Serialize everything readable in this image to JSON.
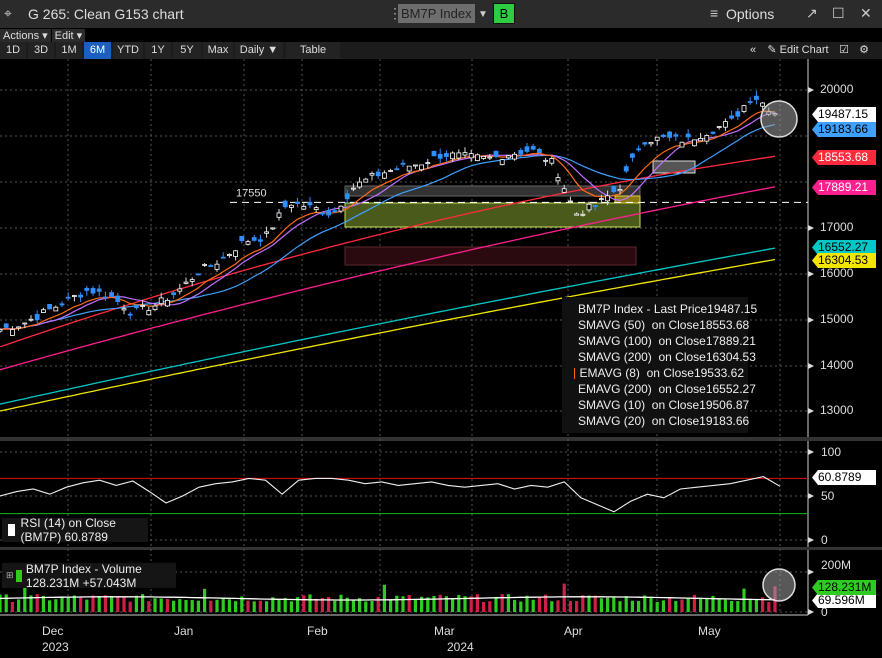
{
  "window": {
    "title": "G 265: Clean G153 chart",
    "ticker": "BM7P Index",
    "b_button": "B",
    "options": "Options",
    "move_icon": "crosshair-move-icon"
  },
  "menus": {
    "actions": "Actions ▾",
    "edit": "Edit ▾"
  },
  "ranges": [
    "1D",
    "3D",
    "1M",
    "6M",
    "YTD",
    "1Y",
    "5Y",
    "Max"
  ],
  "active_range": "6M",
  "frequency": "Daily ▼",
  "table": "Table",
  "edit_chart": "Edit Chart",
  "colors": {
    "up": "#ffffff",
    "down": "#2f8fff",
    "sma50": "#ff2a3c",
    "sma100": "#ff1f8f",
    "sma200": "#f2e600",
    "ema8": "#ff6a13",
    "ema200": "#00c8c8",
    "sma10": "#c070ff",
    "sma20": "#3fa0ff",
    "vol_up": "#2ecc20",
    "vol_down": "#d0204a"
  },
  "chart_data": {
    "type": "candlestick",
    "period": "Dec 2023 - May 2024",
    "price_ylim": [
      12500,
      20300
    ],
    "price_ticks": [
      "20000",
      "17000",
      "16000",
      "15000",
      "14000",
      "13000"
    ],
    "hidden_ticks": [
      19000,
      18000
    ],
    "approx_close_path": [
      14780,
      14900,
      15150,
      15400,
      15650,
      15500,
      15150,
      15300,
      15600,
      16050,
      16300,
      16700,
      16800,
      17550,
      17450,
      17300,
      17900,
      18150,
      18300,
      18400,
      18600,
      18550,
      18500,
      18600,
      18700,
      18400,
      17300,
      17500,
      17900,
      18900,
      18950,
      18900,
      19100,
      19300,
      19900,
      19487.15
    ],
    "horizontal_line": {
      "value": 17550,
      "label": "17550"
    },
    "last_price": "19487.15",
    "legend": [
      {
        "name": "BM7P Index - Last Price",
        "value": "19487.15",
        "color": "#ffffff"
      },
      {
        "name": "SMAVG (50)  on Close",
        "value": "18553.68",
        "color": "#ff2a3c"
      },
      {
        "name": "SMAVG (100)  on Close",
        "value": "17889.21",
        "color": "#ff1f8f"
      },
      {
        "name": "SMAVG (200)  on Close",
        "value": "16304.53",
        "color": "#f2e600"
      },
      {
        "name": "EMAVG (8)  on Close",
        "value": "19533.62",
        "color": "#ff6a13"
      },
      {
        "name": "EMAVG (200)  on Close",
        "value": "16552.27",
        "color": "#00c8c8"
      },
      {
        "name": "SMAVG (10)  on Close",
        "value": "19506.87",
        "color": "#c070ff"
      },
      {
        "name": "SMAVG (20)  on Close",
        "value": "19183.66",
        "color": "#3fa0ff"
      }
    ],
    "ma_endpoints": {
      "sma50": [
        14400,
        18553.68
      ],
      "sma100": [
        13900,
        17889.21
      ],
      "ema200": [
        13150,
        16552.27
      ],
      "sma200": [
        13000,
        16304.53
      ]
    },
    "tags": [
      {
        "value": "19487.15",
        "bg": "#ffffff",
        "fg": "#000000"
      },
      {
        "value": "19183.66",
        "bg": "#3fa0ff",
        "fg": "#000000"
      },
      {
        "value": "18553.68",
        "bg": "#ff2a3c",
        "fg": "#ffffff"
      },
      {
        "value": "17889.21",
        "bg": "#ff1f8f",
        "fg": "#ffffff"
      },
      {
        "value": "16552.27",
        "bg": "#00c8c8",
        "fg": "#000000"
      },
      {
        "value": "16304.53",
        "bg": "#f2e600",
        "fg": "#000000"
      }
    ],
    "rsi": {
      "label": "RSI (14)  on Close (BM7P) 60.8789",
      "value": "60.8789",
      "ticks": [
        "100",
        "50",
        "0"
      ],
      "overbought": 70,
      "oversold": 30,
      "path": [
        50,
        55,
        58,
        52,
        60,
        65,
        68,
        62,
        67,
        55,
        42,
        50,
        60,
        64,
        66,
        70,
        68,
        52,
        68,
        70,
        70,
        68,
        64,
        66,
        62,
        64,
        66,
        62,
        60,
        62,
        64,
        58,
        62,
        60,
        66,
        48,
        40,
        32,
        44,
        52,
        48,
        58,
        60,
        62,
        64,
        68,
        72,
        61
      ]
    },
    "volume": {
      "label": "BM7P Index - Volume 128.231M  +57.043M",
      "ticks": [
        "200M",
        "0"
      ],
      "last": "128.231M",
      "avg": "69.596M"
    },
    "x_months": [
      "Dec",
      "Jan",
      "Feb",
      "Mar",
      "Apr",
      "May"
    ],
    "x_years": [
      "2023",
      "2024"
    ]
  }
}
